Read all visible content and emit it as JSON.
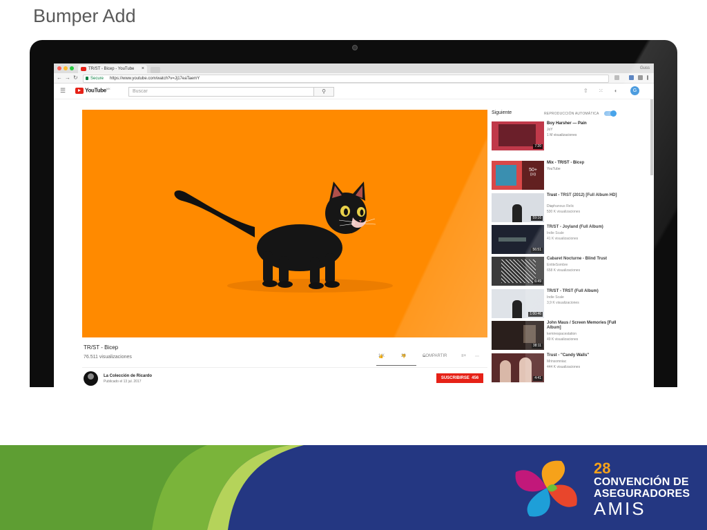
{
  "slide": {
    "title": "Bumper Add"
  },
  "browser": {
    "tab_title": "TR/ST - Bicep - YouTube",
    "tab_close": "×",
    "profile": "Guss",
    "secure_label": "Secure",
    "url": "https://www.youtube.com/watch?v=Jj17eaTaemY",
    "back": "←",
    "forward": "→",
    "reload": "↻"
  },
  "youtube": {
    "logo_text": "YouTube",
    "logo_region": "MX",
    "search_placeholder": "Buscar",
    "avatar_letter": "G"
  },
  "video": {
    "title": "TR/ST - Bicep",
    "views": "76.511 visualizaciones",
    "likes": "1 K",
    "dislikes": "20",
    "share": "COMPARTIR",
    "channel": "La Colección de Ricardo",
    "published": "Publicado el 13 jul. 2017",
    "subscribe": "SUSCRIBIRSE",
    "subscribers": "456"
  },
  "sidebar": {
    "up_next": "Siguiente",
    "autoplay": "REPRODUCCIÓN AUTOMÁTICA",
    "items": [
      {
        "title": "Boy Harsher — Pain",
        "channel": "JoY",
        "views": "1 M visualizaciones",
        "duration": "7:20",
        "thumb": "#c0394a"
      },
      {
        "title": "Mix - TR/ST - Bicep",
        "channel": "YouTube",
        "views": "",
        "duration": "",
        "mix_count": "50+",
        "mix_icon": "((•))",
        "thumb": "#d94848"
      },
      {
        "title": "Trust - TRST (2012) [Full Album HD]",
        "channel": "Diaphanous Relic",
        "views": "530 K visualizaciones",
        "duration": "59:16",
        "thumb": "#d9dde3"
      },
      {
        "title": "TR/ST - Joyland (Full Album)",
        "channel": "Indie Scale",
        "views": "41 K visualizaciones",
        "duration": "56:51",
        "thumb": "#1d2230"
      },
      {
        "title": "Cabaret Nocturne - Blind Trust",
        "channel": "EntiteSombre",
        "views": "658 K visualizaciones",
        "duration": "6:49",
        "thumb": "#3b3b3b"
      },
      {
        "title": "TR/ST - TRST (Full Album)",
        "channel": "Indie Scale",
        "views": "3,9 K visualizaciones",
        "duration": "1:00:46",
        "thumb": "#dfe3e8"
      },
      {
        "title": "John Maus / Screen Memories [Full Album]",
        "channel": "kemirespacestation",
        "views": "49 K visualizaciones",
        "duration": "38:11",
        "thumb": "#2a1f1c"
      },
      {
        "title": "Trust - \"Candy Walls\"",
        "channel": "Mrinsomniac",
        "views": "444 K visualizaciones",
        "duration": "4:41",
        "thumb": "#5a2b2b"
      }
    ]
  },
  "footer": {
    "number": "28",
    "line1": "CONVENCIÓN DE",
    "line2": "ASEGURADORES",
    "line3": "AMIS",
    "colors": {
      "navy": "#243782",
      "green": "#7ab43a",
      "orange": "#f6a21a"
    }
  }
}
